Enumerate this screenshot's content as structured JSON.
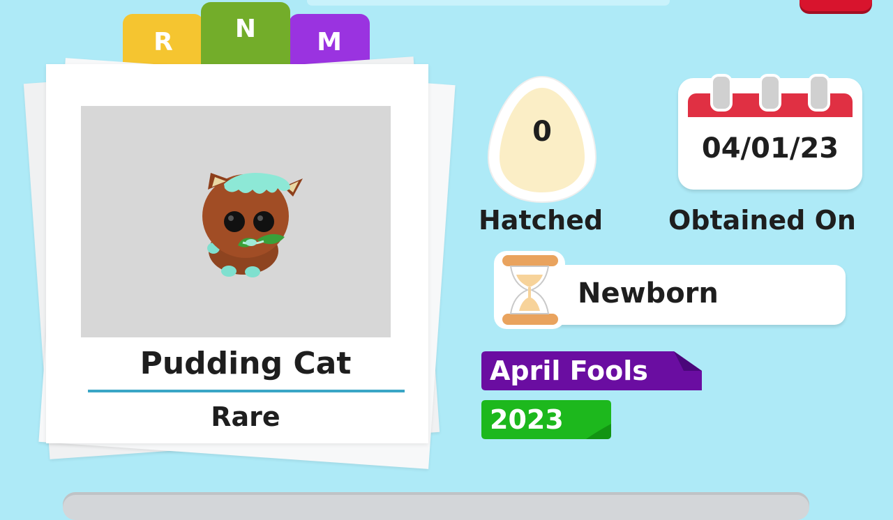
{
  "tabs": [
    {
      "label": "R",
      "color": "#f5c530"
    },
    {
      "label": "N",
      "color": "#73ad2a"
    },
    {
      "label": "M",
      "color": "#9a33e0"
    }
  ],
  "pet": {
    "name": "Pudding Cat",
    "rarity": "Rare",
    "image_icon": "pudding-cat-icon"
  },
  "stats": {
    "hatched_count": "0",
    "hatched_label": "Hatched",
    "obtained_date": "04/01/23",
    "obtained_label": "Obtained On"
  },
  "age": {
    "label": "Newborn",
    "icon": "hourglass-icon"
  },
  "tags": {
    "event": {
      "label": "April Fools",
      "color": "#6a0da1"
    },
    "year": {
      "label": "2023",
      "color": "#1db81d"
    }
  },
  "colors": {
    "background": "#aeeaf7",
    "close_button": "#d8142d",
    "divider": "#3aa6c6"
  }
}
